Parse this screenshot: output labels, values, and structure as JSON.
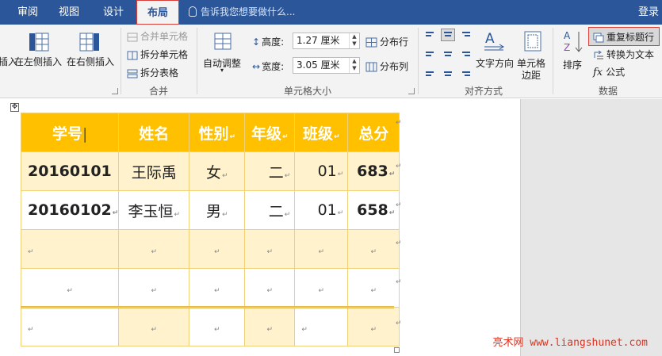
{
  "tabs": [
    {
      "label": "审阅"
    },
    {
      "label": "视图"
    },
    {
      "label": "设计"
    },
    {
      "label": "布局"
    }
  ],
  "tell_me": "告诉我您想要做什么...",
  "login": "登录",
  "ribbon": {
    "rows_cols": {
      "insert_below_partial": "插入",
      "insert_left": "在左侧插入",
      "insert_right": "在右侧插入"
    },
    "merge": {
      "merge_cells": "合并单元格",
      "split_cells": "拆分单元格",
      "split_table": "拆分表格",
      "label": "合并"
    },
    "cell_size": {
      "autofit": "自动调整",
      "height_label": "高度:",
      "height_value": "1.27 厘米",
      "width_label": "宽度:",
      "width_value": "3.05 厘米",
      "distribute_rows": "分布行",
      "distribute_cols": "分布列",
      "label": "单元格大小"
    },
    "alignment": {
      "text_direction": "文字方向",
      "cell_margins_1": "单元格",
      "cell_margins_2": "边距",
      "label": "对齐方式"
    },
    "data": {
      "sort": "排序",
      "repeat_header": "重复标题行",
      "convert_to_text": "转换为文本",
      "formula": "公式",
      "label": "数据"
    }
  },
  "table": {
    "headers": [
      "学号",
      "姓名",
      "性别",
      "年级",
      "班级",
      "总分"
    ],
    "rows": [
      [
        "20160101",
        "王际禹",
        "女",
        "二",
        "01",
        "683"
      ],
      [
        "20160102",
        "李玉恒",
        "男",
        "二",
        "01",
        "658"
      ]
    ]
  },
  "watermark": "亮术网 www.liangshunet.com",
  "colors": {
    "title_bar": "#2b579a",
    "header_fill": "#ffc000",
    "band_fill": "#fff2cc",
    "highlight_border": "#d9403a"
  }
}
